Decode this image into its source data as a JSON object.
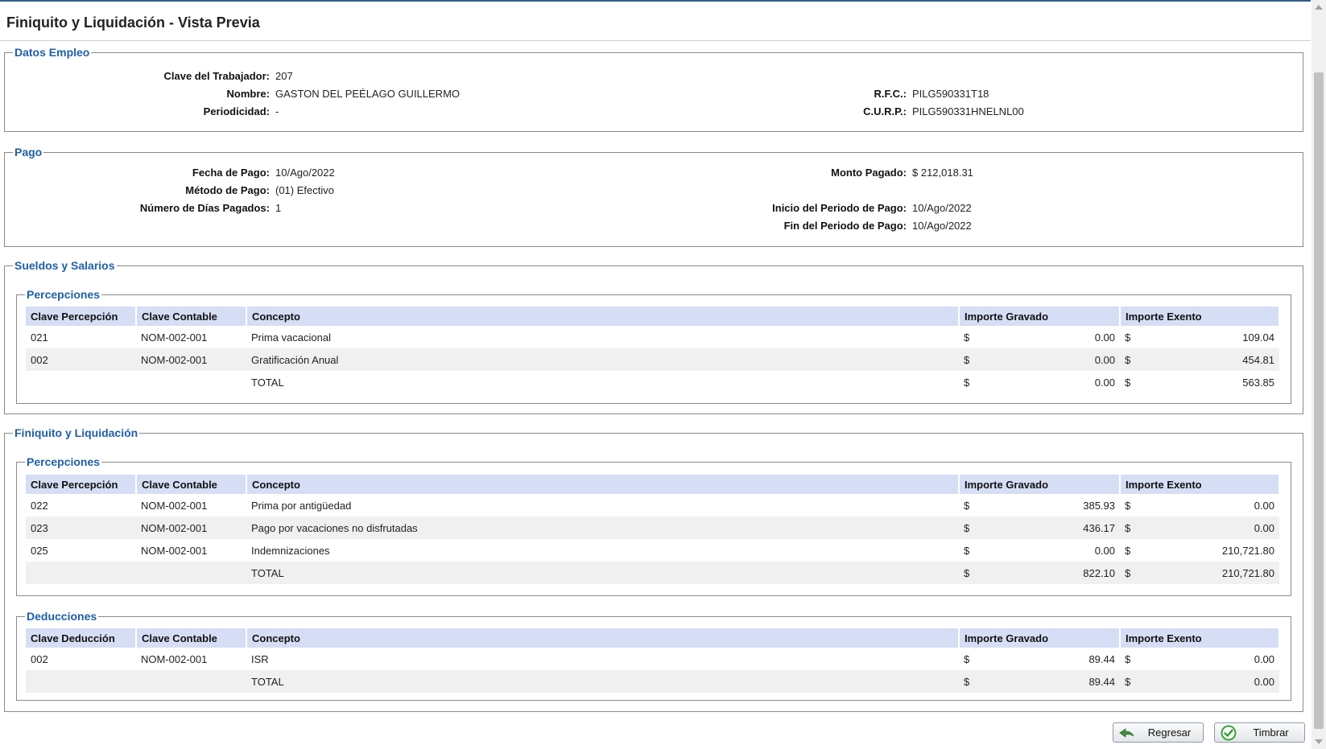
{
  "page": {
    "title": "Finiquito y Liquidación - Vista Previa"
  },
  "datos_empleo": {
    "legend": "Datos Empleo",
    "clave_label": "Clave del Trabajador:",
    "clave_value": "207",
    "nombre_label": "Nombre:",
    "nombre_value": "GASTON DEL PEÉLAGO GUILLERMO",
    "periodicidad_label": "Periodicidad:",
    "periodicidad_value": "-",
    "rfc_label": "R.F.C.:",
    "rfc_value": "PILG590331T18",
    "curp_label": "C.U.R.P.:",
    "curp_value": "PILG590331HNELNL00"
  },
  "pago": {
    "legend": "Pago",
    "fecha_label": "Fecha de Pago:",
    "fecha_value": "10/Ago/2022",
    "metodo_label": "Método de Pago:",
    "metodo_value": "(01) Efectivo",
    "dias_label": "Número de Días Pagados:",
    "dias_value": "1",
    "monto_label": "Monto Pagado:",
    "monto_value": "$ 212,018.31",
    "inicio_label": "Inicio del Periodo de Pago:",
    "inicio_value": "10/Ago/2022",
    "fin_label": "Fin del Periodo de Pago:",
    "fin_value": "10/Ago/2022"
  },
  "sueldos": {
    "legend": "Sueldos y Salarios",
    "percepciones": {
      "legend": "Percepciones",
      "headers": [
        "Clave Percepción",
        "Clave Contable",
        "Concepto",
        "Importe Gravado",
        "Importe Exento"
      ],
      "rows": [
        {
          "clave": "021",
          "contable": "NOM-002-001",
          "concepto": "Prima vacacional",
          "cur1": "$",
          "gravado": "0.00",
          "cur2": "$",
          "exento": "109.04"
        },
        {
          "clave": "002",
          "contable": "NOM-002-001",
          "concepto": "Gratificación Anual",
          "cur1": "$",
          "gravado": "0.00",
          "cur2": "$",
          "exento": "454.81"
        }
      ],
      "total": {
        "label": "TOTAL",
        "cur1": "$",
        "gravado": "0.00",
        "cur2": "$",
        "exento": "563.85"
      }
    }
  },
  "finiquito": {
    "legend": "Finiquito y Liquidación",
    "percepciones": {
      "legend": "Percepciones",
      "headers": [
        "Clave Percepción",
        "Clave Contable",
        "Concepto",
        "Importe Gravado",
        "Importe Exento"
      ],
      "rows": [
        {
          "clave": "022",
          "contable": "NOM-002-001",
          "concepto": "Prima por antigüedad",
          "cur1": "$",
          "gravado": "385.93",
          "cur2": "$",
          "exento": "0.00"
        },
        {
          "clave": "023",
          "contable": "NOM-002-001",
          "concepto": "Pago por vacaciones no disfrutadas",
          "cur1": "$",
          "gravado": "436.17",
          "cur2": "$",
          "exento": "0.00"
        },
        {
          "clave": "025",
          "contable": "NOM-002-001",
          "concepto": "Indemnizaciones",
          "cur1": "$",
          "gravado": "0.00",
          "cur2": "$",
          "exento": "210,721.80"
        }
      ],
      "total": {
        "label": "TOTAL",
        "cur1": "$",
        "gravado": "822.10",
        "cur2": "$",
        "exento": "210,721.80"
      }
    },
    "deducciones": {
      "legend": "Deducciones",
      "headers": [
        "Clave Deducción",
        "Clave Contable",
        "Concepto",
        "Importe Gravado",
        "Importe Exento"
      ],
      "rows": [
        {
          "clave": "002",
          "contable": "NOM-002-001",
          "concepto": "ISR",
          "cur1": "$",
          "gravado": "89.44",
          "cur2": "$",
          "exento": "0.00"
        }
      ],
      "total": {
        "label": "TOTAL",
        "cur1": "$",
        "gravado": "89.44",
        "cur2": "$",
        "exento": "0.00"
      }
    }
  },
  "buttons": {
    "regresar": {
      "label": "Regresar",
      "icon": "back-arrow-icon"
    },
    "timbrar": {
      "label": "Timbrar",
      "icon": "checkmark-icon"
    }
  },
  "colors": {
    "legend": "#1f5fa8",
    "header_bg": "#d6def5",
    "row_alt": "#f0f0f0"
  }
}
